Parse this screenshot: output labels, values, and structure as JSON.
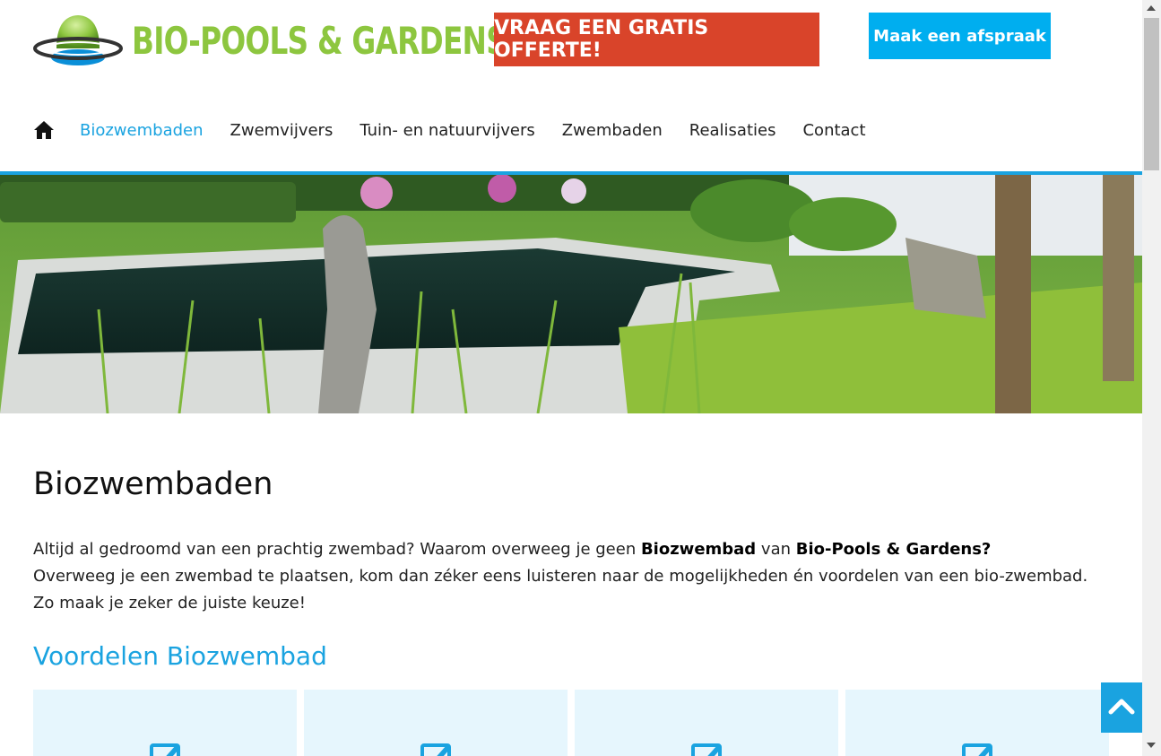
{
  "colors": {
    "brand_green": "#8dc63f",
    "accent_blue": "#1aa3e0",
    "cta_red": "#d9442a",
    "button_blue": "#00aeef",
    "card_bg": "#e6f6fd"
  },
  "header": {
    "logo_text": "BIO-POOLS & GARDENS",
    "cta_offerte": "VRAAG EEN GRATIS OFFERTE!",
    "cta_afspraak": "Maak een afspraak"
  },
  "nav": {
    "home_icon": "home-icon",
    "items": [
      {
        "label": "Biozwembaden",
        "active": true
      },
      {
        "label": "Zwemvijvers"
      },
      {
        "label": "Tuin- en natuurvijvers"
      },
      {
        "label": "Zwembaden"
      },
      {
        "label": "Realisaties"
      },
      {
        "label": "Contact"
      }
    ]
  },
  "hero": {
    "icon": "garden-pool-photo"
  },
  "main": {
    "title": "Biozwembaden",
    "intro": {
      "p1_a": "Altijd al gedroomd van een prachtig zwembad? Waarom overweeg je geen ",
      "p1_b": "Biozwembad",
      "p1_c": " van ",
      "p1_d": "Bio-Pools & Gardens?",
      "p2": "Overweeg je een zwembad te plaatsen, kom dan zéker eens luisteren naar de mogelijkheden én voordelen van een bio-zwembad. Zo maak je zeker de juiste keuze!"
    },
    "section_title": "Voordelen Biozwembad",
    "cards": [
      {
        "icon": "edit-icon"
      },
      {
        "icon": "edit-icon"
      },
      {
        "icon": "edit-icon"
      },
      {
        "icon": "edit-icon"
      }
    ]
  },
  "back_to_top": {
    "icon": "chevron-up-icon"
  }
}
